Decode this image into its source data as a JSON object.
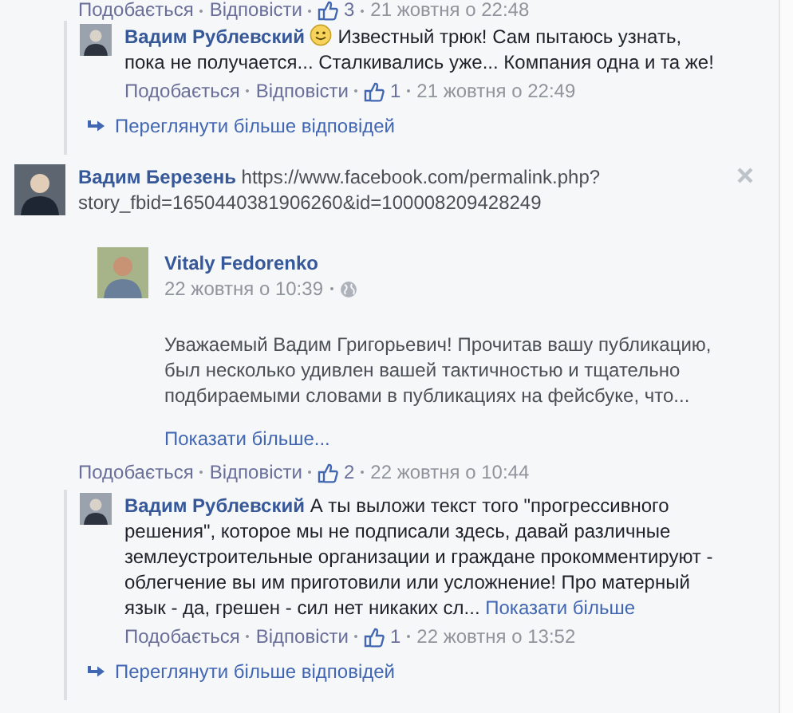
{
  "previous_thread": {
    "actions": {
      "like": "Подобається",
      "reply": "Відповісти",
      "likes": "3",
      "time": "21 жовтня о 22:48"
    },
    "replies": [
      {
        "author": "Вадим Рублевский",
        "smiley": true,
        "text": "Известный трюк! Сам пытаюсь узнать, пока не получается... Сталкивались уже... Компания одна и та же!",
        "actions": {
          "like": "Подобається",
          "reply": "Відповісти",
          "likes": "1",
          "time": "21 жовтня о 22:49"
        }
      }
    ],
    "more_replies": "Переглянути більше відповідей"
  },
  "comment": {
    "author": "Вадим Березень",
    "text": "https://www.facebook.com/permalink.php?story_fbid=1650440381906260&id=100008209428249",
    "attachment": {
      "author": "Vitaly Fedorenko",
      "time": "22 жовтня о 10:39",
      "body": "Уважаемый Вадим Григорьевич! Прочитав вашу публикацию, был несколько удивлен вашей тактичностью и тщательно подбираемыми словами в публикациях на фейсбуке, что...",
      "show_more": "Показати більше..."
    },
    "actions": {
      "like": "Подобається",
      "reply": "Відповісти",
      "likes": "2",
      "time": "22 жовтня о 10:44"
    },
    "replies": [
      {
        "author": "Вадим Рублевский",
        "text": "А ты выложи текст того \"прогрессивного решения\", которое мы не подписали здесь, давай различные землеустроительные организации и граждане прокомментируют - облегчение вы им приготовили или усложнение! Про матерный язык - да, грешен - сил нет никаких сл...",
        "show_more": "Показати більше",
        "actions": {
          "like": "Подобається",
          "reply": "Відповісти",
          "likes": "1",
          "time": "22 жовтня о 13:52"
        }
      }
    ],
    "more_replies": "Переглянути більше відповідей"
  }
}
